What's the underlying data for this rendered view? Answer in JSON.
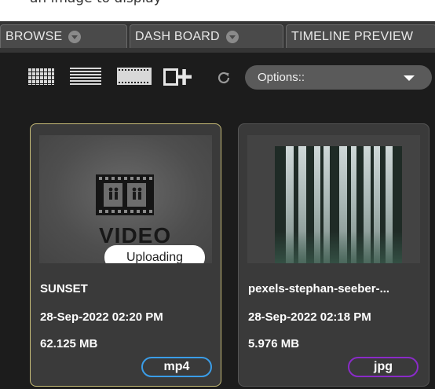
{
  "header": {
    "caption": "an image to display"
  },
  "tabs": [
    {
      "label": "BROWSE"
    },
    {
      "label": "DASH BOARD"
    },
    {
      "label": "TIMELINE PREVIEW"
    }
  ],
  "toolbar": {
    "icons": [
      "grid-view-icon",
      "list-view-icon",
      "filmstrip-view-icon",
      "add-item-icon",
      "refresh-icon"
    ],
    "options": {
      "selected": "Options::"
    }
  },
  "media": [
    {
      "name": "SUNSET",
      "date": "28-Sep-2022 02:20 PM",
      "size": "62.125 MB",
      "ext": "mp4",
      "ext_color": "#3a9de8",
      "thumb_text": "VIDEO",
      "status": "Uploading",
      "selected": true
    },
    {
      "name": "pexels-stephan-seeber-...",
      "date": "28-Sep-2022 02:18 PM",
      "size": "5.976 MB",
      "ext": "jpg",
      "ext_color": "#8a2bc8",
      "selected": false
    }
  ]
}
